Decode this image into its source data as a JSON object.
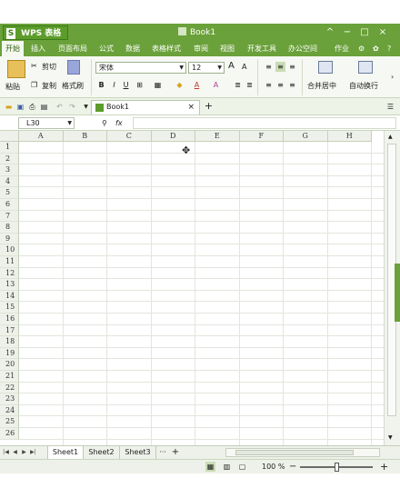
{
  "app": {
    "logo_letter": "S",
    "logo_text": "WPS 表格",
    "doc_title": "Book1"
  },
  "window_controls": {
    "collapse": "^",
    "minimize": "−",
    "maximize": "□",
    "close": "×"
  },
  "menu": {
    "items": [
      "开始",
      "插入",
      "页面布局",
      "公式",
      "数据",
      "表格样式",
      "审阅",
      "视图",
      "开发工具",
      "办公空间"
    ],
    "right_label": "作业",
    "help": "?"
  },
  "ribbon": {
    "paste_label": "粘贴",
    "cut_label": "剪切",
    "copy_label": "复制",
    "format_painter_label": "格式刷",
    "font_name": "宋体",
    "font_size": "12",
    "grow_font": "A",
    "shrink_font": "A",
    "bold": "B",
    "italic": "I",
    "underline": "U",
    "merge_label": "合并居中",
    "wrap_label": "自动换行"
  },
  "tabs": {
    "doc_tab_label": "Book1",
    "close_icon": "×",
    "new_tab_icon": "+"
  },
  "formula_bar": {
    "name_box": "L30",
    "fx_label": "fx",
    "formula_value": ""
  },
  "grid": {
    "columns": [
      "A",
      "B",
      "C",
      "D",
      "E",
      "F",
      "G",
      "H"
    ],
    "rows": [
      "1",
      "2",
      "3",
      "4",
      "5",
      "6",
      "7",
      "8",
      "9",
      "10",
      "11",
      "12",
      "13",
      "14",
      "15",
      "16",
      "17",
      "18",
      "19",
      "20",
      "21",
      "22",
      "23",
      "24",
      "25",
      "26"
    ]
  },
  "sheets": {
    "tabs": [
      "Sheet1",
      "Sheet2",
      "Sheet3"
    ],
    "active": "Sheet1",
    "more": "···",
    "add": "+"
  },
  "status": {
    "zoom_label": "100 %",
    "zoom_minus": "−",
    "zoom_plus": "+"
  },
  "colors": {
    "brand_green": "#6aa13a",
    "logo_green": "#5c9c2b",
    "grid_line": "#e2e6dd",
    "header_bg": "#eef1ea"
  }
}
